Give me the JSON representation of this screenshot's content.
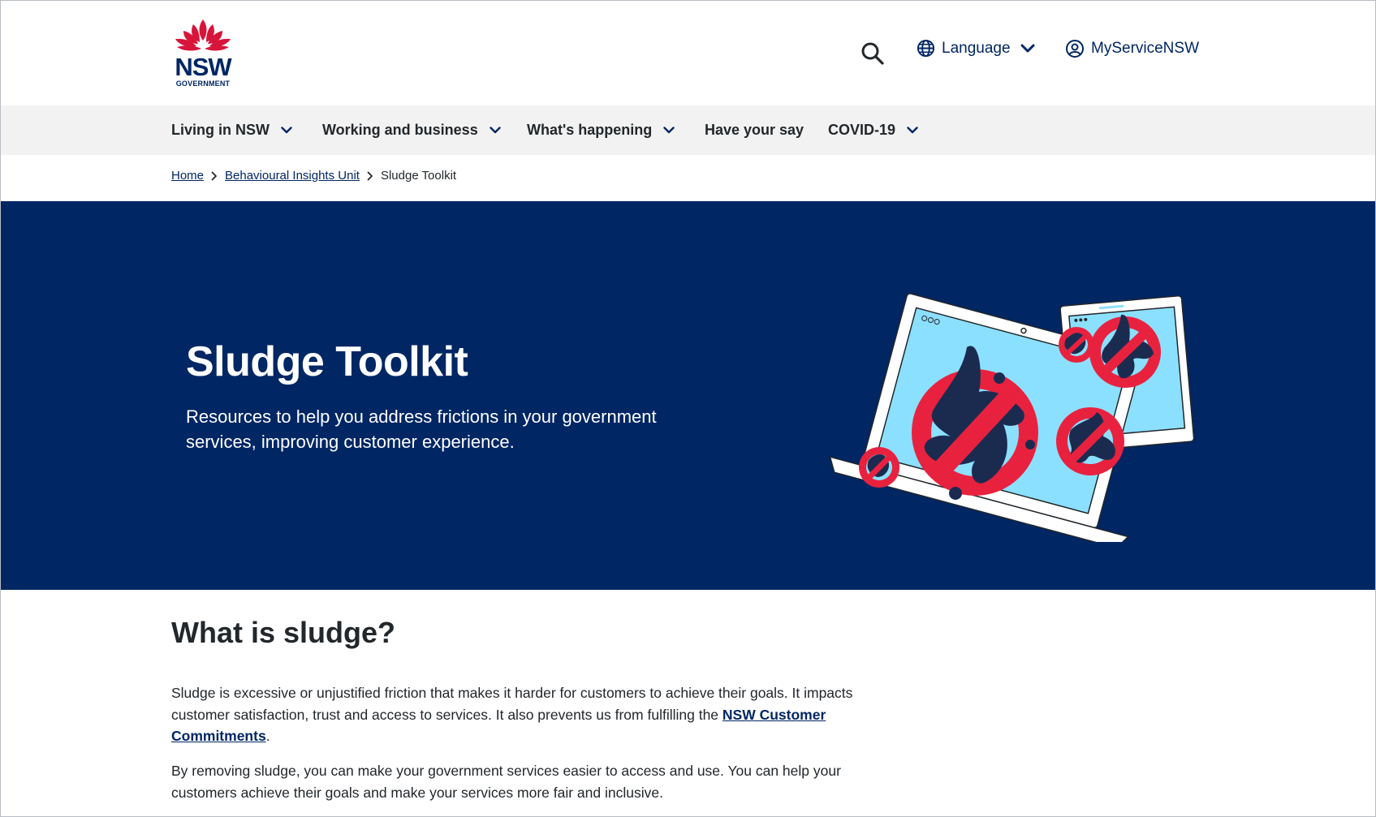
{
  "header": {
    "logo_text": "NSW",
    "logo_subtext": "GOVERNMENT",
    "search_icon": "search-icon",
    "language_label": "Language",
    "account_label": "MyServiceNSW"
  },
  "nav": {
    "items": [
      {
        "label": "Living in NSW",
        "has_dropdown": true
      },
      {
        "label": "Working and business",
        "has_dropdown": true
      },
      {
        "label": "What's happening",
        "has_dropdown": true
      },
      {
        "label": "Have your say",
        "has_dropdown": false
      },
      {
        "label": "COVID-19",
        "has_dropdown": true
      }
    ]
  },
  "breadcrumb": {
    "items": [
      "Home",
      "Behavioural Insights Unit"
    ],
    "current": "Sludge Toolkit"
  },
  "hero": {
    "title": "Sludge Toolkit",
    "subtitle": "Resources to help you address frictions in your government services, improving customer experience."
  },
  "content": {
    "heading": "What is sludge?",
    "p1_text": "Sludge is excessive or unjustified friction that makes it harder for customers to achieve their goals. It impacts customer satisfaction, trust and access to services. It also prevents us from fulfilling the ",
    "p1_link": "NSW Customer Commitments",
    "p1_end": ".",
    "p2_text": "By removing sludge, you can make your government services easier to access and use. You can help your customers achieve their goals and make your services more fair and inclusive."
  },
  "colors": {
    "brand_navy": "#002664",
    "brand_red": "#d7153a",
    "nav_bg": "#f2f2f2",
    "illustration_blue": "#8ce0ff"
  }
}
